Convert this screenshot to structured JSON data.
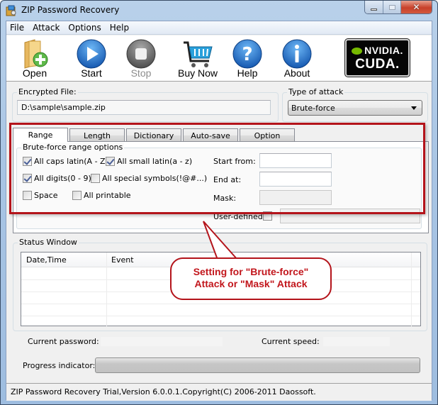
{
  "window": {
    "title": "ZIP Password Recovery",
    "controls": {
      "minimize": "minimize",
      "maximize": "maximize",
      "close": "close"
    }
  },
  "menu": [
    "File",
    "Attack",
    "Options",
    "Help"
  ],
  "toolbar": {
    "open": "Open",
    "start": "Start",
    "stop": "Stop",
    "buy": "Buy Now",
    "help": "Help",
    "about": "About",
    "badge": {
      "brand": "NVIDIA.",
      "product": "CUDA."
    },
    "colors": {
      "blue": "#1d6fc9",
      "green": "#4cae3a",
      "gray": "#6d6d6d"
    }
  },
  "encrypted_file": {
    "label": "Encrypted File:",
    "value": "D:\\sample\\sample.zip"
  },
  "attack_type": {
    "label": "Type of attack",
    "selected": "Brute-force"
  },
  "tabs": [
    "Range",
    "Length",
    "Dictionary",
    "Auto-save",
    "Option"
  ],
  "active_tab": "Range",
  "range": {
    "group_label": "Brute-force range options",
    "checkboxes": [
      {
        "label": "All caps latin(A - Z)",
        "checked": true
      },
      {
        "label": "All small latin(a - z)",
        "checked": true
      },
      {
        "label": "All digits(0 - 9)",
        "checked": true
      },
      {
        "label": "All special symbols(!@#...)",
        "checked": false
      },
      {
        "label": "Space",
        "checked": false
      },
      {
        "label": "All printable",
        "checked": false
      }
    ],
    "start_from": {
      "label": "Start from:",
      "value": ""
    },
    "end_at": {
      "label": "End at:",
      "value": ""
    },
    "mask": {
      "label": "Mask:",
      "value": ""
    },
    "user_defined": {
      "label": "User-defined",
      "checked": false,
      "value": ""
    }
  },
  "status": {
    "group_label": "Status Window",
    "columns": [
      "Date,Time",
      "Event"
    ],
    "rows": []
  },
  "callout": {
    "line1": "Setting for \"Brute-force\"",
    "line2": "Attack or \"Mask\" Attack",
    "color": "#b4141b"
  },
  "current_password": {
    "label": "Current password:",
    "value": ""
  },
  "current_speed": {
    "label": "Current speed:",
    "value": ""
  },
  "progress": {
    "label": "Progress indicator:",
    "percent": 0
  },
  "statusbar": {
    "text": "ZIP Password Recovery Trial,Version 6.0.0.1.Copyright(C) 2006-2011 Daossoft."
  }
}
